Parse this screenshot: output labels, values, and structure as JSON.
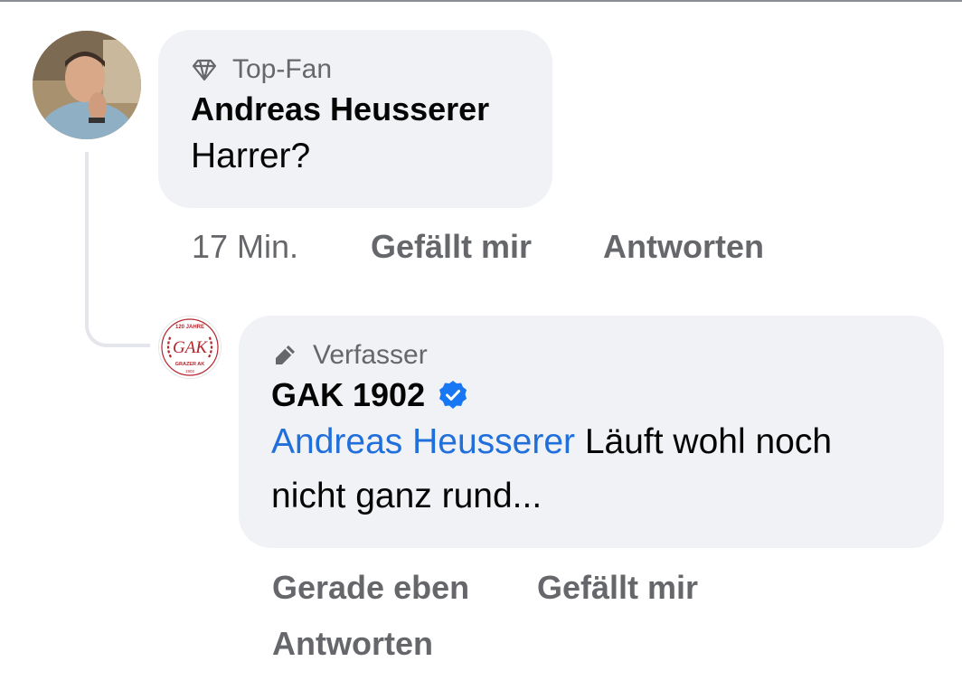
{
  "comments": [
    {
      "badge": "Top-Fan",
      "author": "Andreas Heusserer",
      "text": "Harrer?",
      "time": "17 Min.",
      "like_label": "Gefällt mir",
      "reply_label": "Antworten"
    },
    {
      "badge": "Verfasser",
      "author": "GAK 1902",
      "verified": true,
      "mention": "Andreas Heusserer",
      "text_after_mention": " Läuft wohl noch nicht ganz rund...",
      "time": "Gerade eben",
      "like_label": "Gefällt mir",
      "reply_label": "Antworten",
      "avatar_logo_text": {
        "top": "120 JAHRE",
        "monogram": "GAK",
        "bottom": "GRAZER AK",
        "year": "1902"
      }
    }
  ],
  "colors": {
    "bubble": "#f0f2f5",
    "mention": "#216fdb",
    "secondary_text": "#65676b",
    "verified": "#1877f2",
    "logo_red": "#b3262e"
  },
  "icons": {
    "top_fan": "diamond-icon",
    "author": "pencil-icon",
    "verified": "verified-badge-icon"
  }
}
